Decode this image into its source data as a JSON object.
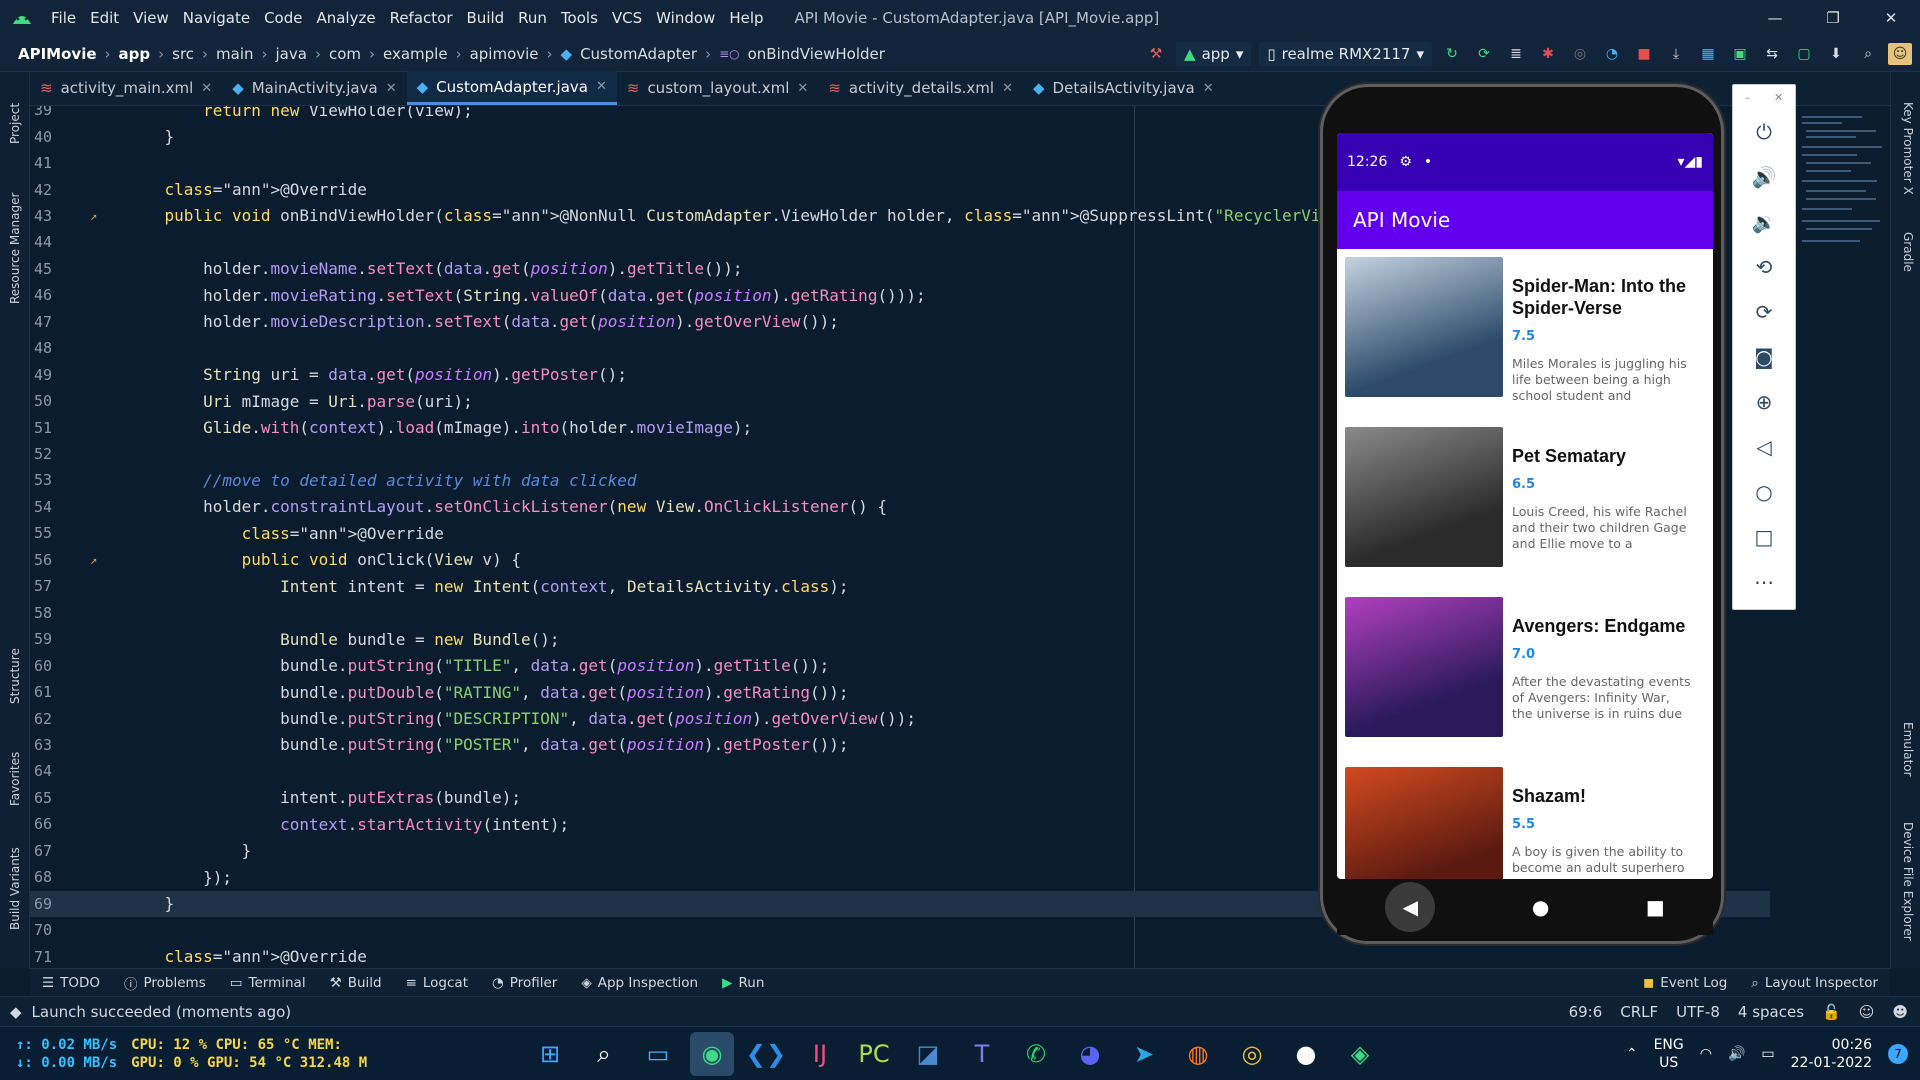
{
  "menu": {
    "items": [
      "File",
      "Edit",
      "View",
      "Navigate",
      "Code",
      "Analyze",
      "Refactor",
      "Build",
      "Run",
      "Tools",
      "VCS",
      "Window",
      "Help"
    ],
    "window_title": "API Movie - CustomAdapter.java [API_Movie.app]"
  },
  "breadcrumb": [
    "APIMovie",
    "app",
    "src",
    "main",
    "java",
    "com",
    "example",
    "apimovie",
    "CustomAdapter",
    "onBindViewHolder"
  ],
  "toolbar": {
    "config": "app",
    "device": "realme RMX2117"
  },
  "tabs": [
    {
      "label": "activity_main.xml",
      "icon": "xml-icon"
    },
    {
      "label": "MainActivity.java",
      "icon": "java-class-icon"
    },
    {
      "label": "CustomAdapter.java",
      "icon": "java-class-icon",
      "active": true
    },
    {
      "label": "custom_layout.xml",
      "icon": "xml-icon"
    },
    {
      "label": "activity_details.xml",
      "icon": "xml-icon"
    },
    {
      "label": "DetailsActivity.java",
      "icon": "java-class-icon"
    }
  ],
  "left_tools": [
    "Project",
    "Resource Manager",
    "Structure",
    "Favorites",
    "Build Variants"
  ],
  "right_tools": [
    "Key Promoter X",
    "Gradle",
    "Emulator",
    "Device File Explorer"
  ],
  "code": {
    "lines": [
      {
        "n": "39",
        "t": "        return new ViewHolder(view);"
      },
      {
        "n": "40",
        "t": "    }"
      },
      {
        "n": "41",
        "t": ""
      },
      {
        "n": "42",
        "t": "    @Override"
      },
      {
        "n": "43",
        "t": "    public void onBindViewHolder(@NonNull CustomAdapter.ViewHolder holder, @SuppressLint(\"RecyclerView\") int position) {"
      },
      {
        "n": "44",
        "t": ""
      },
      {
        "n": "45",
        "t": "        holder.movieName.setText(data.get(position).getTitle());"
      },
      {
        "n": "46",
        "t": "        holder.movieRating.setText(String.valueOf(data.get(position).getRating()));"
      },
      {
        "n": "47",
        "t": "        holder.movieDescription.setText(data.get(position).getOverView());"
      },
      {
        "n": "48",
        "t": ""
      },
      {
        "n": "49",
        "t": "        String uri = data.get(position).getPoster();"
      },
      {
        "n": "50",
        "t": "        Uri mImage = Uri.parse(uri);"
      },
      {
        "n": "51",
        "t": "        Glide.with(context).load(mImage).into(holder.movieImage);"
      },
      {
        "n": "52",
        "t": ""
      },
      {
        "n": "53",
        "t": "        //move to detailed activity with data clicked"
      },
      {
        "n": "54",
        "t": "        holder.constraintLayout.setOnClickListener(new View.OnClickListener() {"
      },
      {
        "n": "55",
        "t": "            @Override"
      },
      {
        "n": "56",
        "t": "            public void onClick(View v) {"
      },
      {
        "n": "57",
        "t": "                Intent intent = new Intent(context, DetailsActivity.class);"
      },
      {
        "n": "58",
        "t": ""
      },
      {
        "n": "59",
        "t": "                Bundle bundle = new Bundle();"
      },
      {
        "n": "60",
        "t": "                bundle.putString(\"TITLE\", data.get(position).getTitle());"
      },
      {
        "n": "61",
        "t": "                bundle.putDouble(\"RATING\", data.get(position).getRating());"
      },
      {
        "n": "62",
        "t": "                bundle.putString(\"DESCRIPTION\", data.get(position).getOverView());"
      },
      {
        "n": "63",
        "t": "                bundle.putString(\"POSTER\", data.get(position).getPoster());"
      },
      {
        "n": "64",
        "t": ""
      },
      {
        "n": "65",
        "t": "                intent.putExtras(bundle);"
      },
      {
        "n": "66",
        "t": "                context.startActivity(intent);"
      },
      {
        "n": "67",
        "t": "            }"
      },
      {
        "n": "68",
        "t": "        });"
      },
      {
        "n": "69",
        "t": "    }",
        "current": true
      },
      {
        "n": "70",
        "t": ""
      },
      {
        "n": "71",
        "t": "    @Override"
      }
    ]
  },
  "phone": {
    "time": "12:26",
    "app_title": "API Movie",
    "movies": [
      {
        "title": "Spider-Man: Into the Spider-Verse",
        "rating": "7.5",
        "overview": "Miles Morales is juggling his life between being a high school student and",
        "colors": [
          "#2d4a6b",
          "#c4d3e0"
        ]
      },
      {
        "title": "Pet Sematary",
        "rating": "6.5",
        "overview": "Louis Creed, his wife Rachel and their two children Gage and Ellie move to a",
        "colors": [
          "#2b2b2b",
          "#8a8a8a"
        ]
      },
      {
        "title": "Avengers: Endgame",
        "rating": "7.0",
        "overview": "After the devastating events of Avengers: Infinity War, the universe is in ruins due",
        "colors": [
          "#2a1a5a",
          "#b040c0"
        ]
      },
      {
        "title": "Shazam!",
        "rating": "5.5",
        "overview": "A boy is given the ability to become an adult superhero",
        "colors": [
          "#5a1a10",
          "#d24a20"
        ]
      }
    ]
  },
  "bottom_tabs": [
    "TODO",
    "Problems",
    "Terminal",
    "Build",
    "Logcat",
    "Profiler",
    "App Inspection",
    "Run"
  ],
  "bottom_right_tabs": [
    "Event Log",
    "Layout Inspector"
  ],
  "status": {
    "message": "Launch succeeded (moments ago)",
    "position": "69:6",
    "line_sep": "CRLF",
    "encoding": "UTF-8",
    "indent": "4 spaces"
  },
  "taskbar": {
    "net_up": "↑: 0.02 MB/s",
    "net_down": "↓: 0.00 MB/s",
    "cpu": "CPU: 12 %",
    "cpu_temp": "CPU: 65 °C",
    "mem": "MEM:",
    "gpu": "GPU: 0 %",
    "gpu_temp": "GPU: 54 °C",
    "mem_val": "312.48 M",
    "lang": "ENG",
    "region": "US",
    "time": "00:26",
    "date": "22-01-2022",
    "notif": "7"
  }
}
